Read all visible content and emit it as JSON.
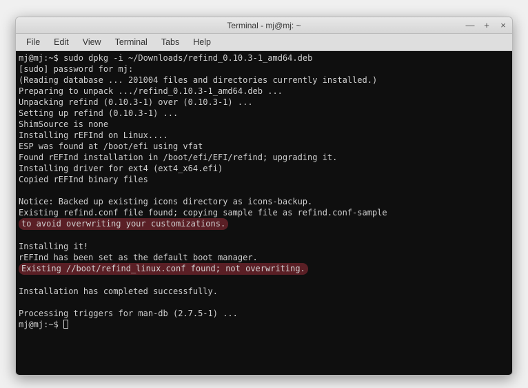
{
  "window": {
    "title": "Terminal - mj@mj: ~",
    "controls": {
      "minimize": "—",
      "maximize": "+",
      "close": "×"
    }
  },
  "menubar": {
    "items": [
      "File",
      "Edit",
      "View",
      "Terminal",
      "Tabs",
      "Help"
    ]
  },
  "terminal": {
    "prompt": {
      "user_host": "mj@mj",
      "sep": ":",
      "path": "~",
      "symbol": "$"
    },
    "command": "sudo dpkg -i ~/Downloads/refind_0.10.3-1_amd64.deb",
    "lines": [
      "[sudo] password for mj:",
      "(Reading database ... 201004 files and directories currently installed.)",
      "Preparing to unpack .../refind_0.10.3-1_amd64.deb ...",
      "Unpacking refind (0.10.3-1) over (0.10.3-1) ...",
      "Setting up refind (0.10.3-1) ...",
      "ShimSource is none",
      "Installing rEFInd on Linux....",
      "ESP was found at /boot/efi using vfat",
      "Found rEFInd installation in /boot/efi/EFI/refind; upgrading it.",
      "Installing driver for ext4 (ext4_x64.efi)",
      "Copied rEFInd binary files",
      "",
      "Notice: Backed up existing icons directory as icons-backup.",
      "Existing refind.conf file found; copying sample file as refind.conf-sample"
    ],
    "highlight1": "to avoid overwriting your customizations.",
    "lines2": [
      "",
      "Installing it!",
      "rEFInd has been set as the default boot manager."
    ],
    "highlight2": "Existing //boot/refind_linux.conf found; not overwriting.",
    "lines3": [
      "",
      "Installation has completed successfully.",
      "",
      "Processing triggers for man-db (2.7.5-1) ..."
    ]
  }
}
